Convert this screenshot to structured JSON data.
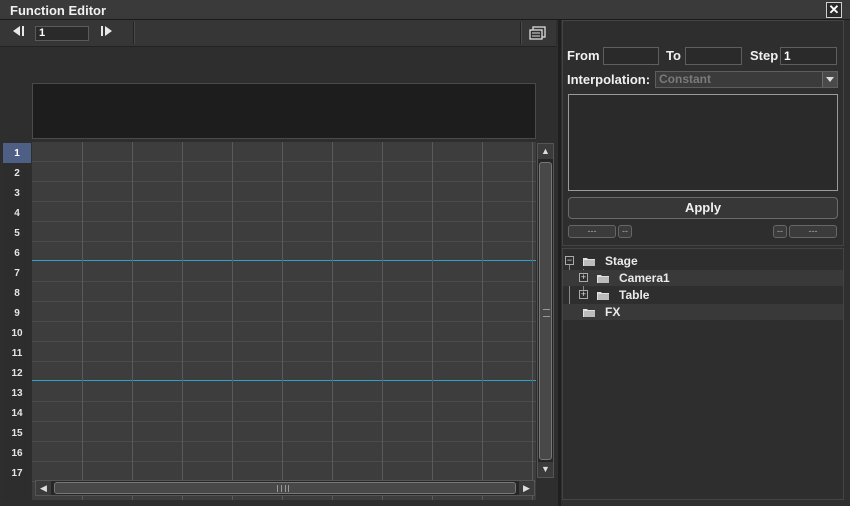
{
  "window": {
    "title": "Function Editor"
  },
  "toolbar": {
    "prev_icon": "step-back-icon",
    "next_icon": "step-forward-icon",
    "frame_value": "1",
    "toggle_icon": "panel-toggle-icon"
  },
  "rows": [
    "1",
    "2",
    "3",
    "4",
    "5",
    "6",
    "7",
    "8",
    "9",
    "10",
    "11",
    "12",
    "13",
    "14",
    "15",
    "16",
    "17"
  ],
  "selected_row": "1",
  "marker_rows": [
    "6",
    "12"
  ],
  "colors": {
    "accent": "#2aa3c9",
    "selected_row": "#4e5f86"
  },
  "range": {
    "from_label": "From",
    "from_value": "",
    "to_label": "To",
    "to_value": "",
    "step_label": "Step",
    "step_value": "1"
  },
  "interpolation": {
    "label": "Interpolation:",
    "value": "Constant"
  },
  "apply_label": "Apply",
  "small_buttons": {
    "left_text": "---",
    "left_sep": "--",
    "right_sep": "--",
    "right_text": "---"
  },
  "tree": [
    {
      "label": "Stage",
      "toggle": "−"
    },
    {
      "label": "Camera1",
      "toggle": "+"
    },
    {
      "label": "Table",
      "toggle": "+"
    },
    {
      "label": "FX",
      "toggle": ""
    }
  ]
}
